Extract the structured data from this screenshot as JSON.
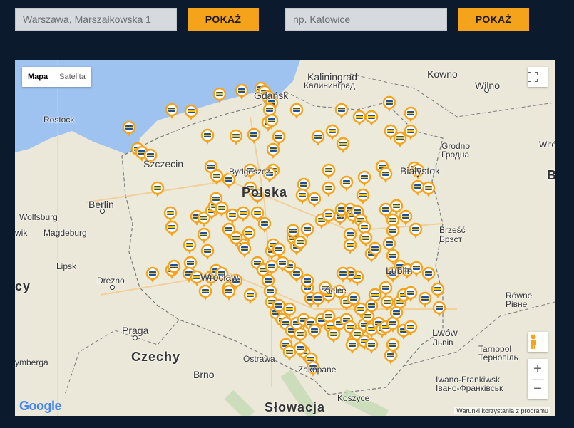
{
  "search1": {
    "value": "Warszawa, Marszałkowska 1",
    "button": "POKAŻ"
  },
  "search2": {
    "placeholder": "np. Katowice",
    "button": "POKAŻ"
  },
  "map": {
    "map_type": [
      "Mapa",
      "Satelita"
    ],
    "active_type": "Mapa",
    "fullscreen_icon": "fullscreen-icon",
    "pegman_icon": "pegman-icon",
    "zoom_in": "+",
    "zoom_out": "−",
    "attribution": "Warunki korzystania z programu",
    "logo": "Google",
    "marker_icon": "bank-marker-icon",
    "marker_color": "#f5a31a",
    "labels": {
      "kaliningrad": "Kaliningrad",
      "kaliningrad_ru": "Калининград",
      "kowno": "Kowno",
      "wilno": "Wilno",
      "rostock": "Rostock",
      "gdansk": "Gdańsk",
      "szczecin": "Szczecin",
      "bydgoszcz": "Bydgoszcz",
      "polska": "Polska",
      "bialystok": "Białystok",
      "berlin": "Berlin",
      "wolfsburg": "Wolfsburg",
      "magdeburg": "Magdeburg",
      "lipsk": "Lipsk",
      "drezno": "Drezno",
      "brzesc": "Brześć",
      "brzesc_ru": "Брэст",
      "grodno": "Grodno",
      "grodno_ru": "Гродна",
      "wroclaw": "Wrocław",
      "kielce": "Kielce",
      "lublin": "Lublin",
      "rowne": "Równe",
      "rowne_ua": "Рівне",
      "lwow": "Lwów",
      "lwow_ua": "Львів",
      "tarnopol": "Tarnopol",
      "tarnopol_ua": "Тернопіль",
      "iwano": "Iwano-Frankiwsk",
      "iwano_ua": "Івано-Франківськ",
      "praga": "Praga",
      "czechy": "Czechy",
      "brno": "Brno",
      "ostrawa": "Ostrawa",
      "zakopane": "Zakopane",
      "koszyce": "Koszyce",
      "slowacja": "Słowacja",
      "wilno2": "Witów",
      "niemcy": "cy",
      "norymberga": "ymberga",
      "uwik": "wik",
      "bial_b": "B"
    }
  }
}
